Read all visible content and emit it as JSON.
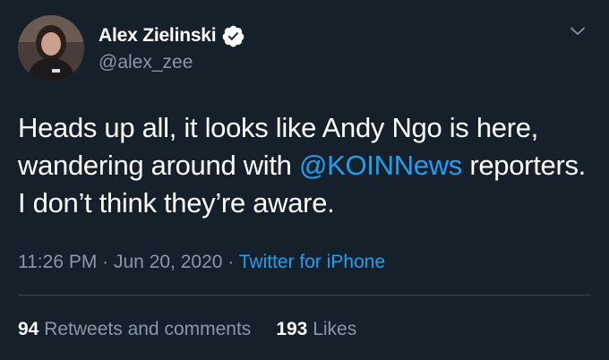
{
  "author": {
    "display_name": "Alex Zielinski",
    "handle": "@alex_zee",
    "verified": true
  },
  "tweet": {
    "text_part1": "Heads up all, it looks like Andy Ngo is here, wandering around with ",
    "mention": "@KOINNews",
    "text_part2": " reporters. I don’t think they’re aware."
  },
  "meta": {
    "time": "11:26 PM",
    "separator1": " · ",
    "date": "Jun 20, 2020",
    "separator2": " · ",
    "source": "Twitter for iPhone"
  },
  "stats": {
    "retweets_count": "94",
    "retweets_label": "Retweets and comments",
    "likes_count": "193",
    "likes_label": "Likes"
  },
  "colors": {
    "background": "#15202b",
    "text_primary": "#ffffff",
    "text_secondary": "#8899a6",
    "accent": "#1da1f2",
    "divider": "#38444d"
  },
  "icons": {
    "verified": "verified-badge-icon",
    "more": "chevron-down-icon"
  }
}
